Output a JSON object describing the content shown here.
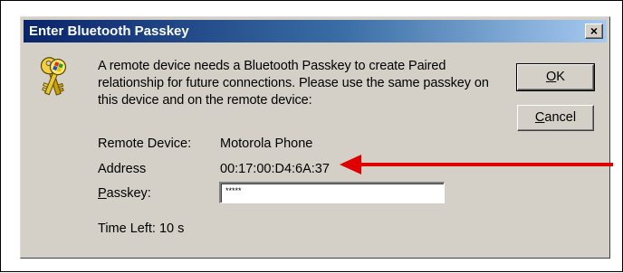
{
  "dialog": {
    "title": "Enter Bluetooth Passkey",
    "close_label": "×",
    "message": "A remote device needs a Bluetooth Passkey to create Paired relationship for future connections. Please use the same passkey on this device and on the remote device:",
    "ok_button": {
      "mnemonic": "O",
      "rest": "K"
    },
    "cancel_button": {
      "mnemonic": "C",
      "rest": "ancel"
    },
    "remote_device": {
      "label": "Remote Device:",
      "value": "Motorola Phone"
    },
    "address": {
      "label": "Address",
      "value": "00:17:00:D4:6A:37"
    },
    "passkey": {
      "label_mnemonic": "P",
      "label_rest": "asskey:",
      "value": "*****"
    },
    "time_left": "Time Left: 10 s"
  },
  "icons": {
    "dialog_icon": "keys-icon",
    "annotation": "red-arrow-annotation"
  },
  "colors": {
    "title_bar_start": "#0a246a",
    "title_bar_end": "#a6caf0",
    "dialog_face": "#d4d0c8",
    "annotation_arrow": "#e00000"
  }
}
